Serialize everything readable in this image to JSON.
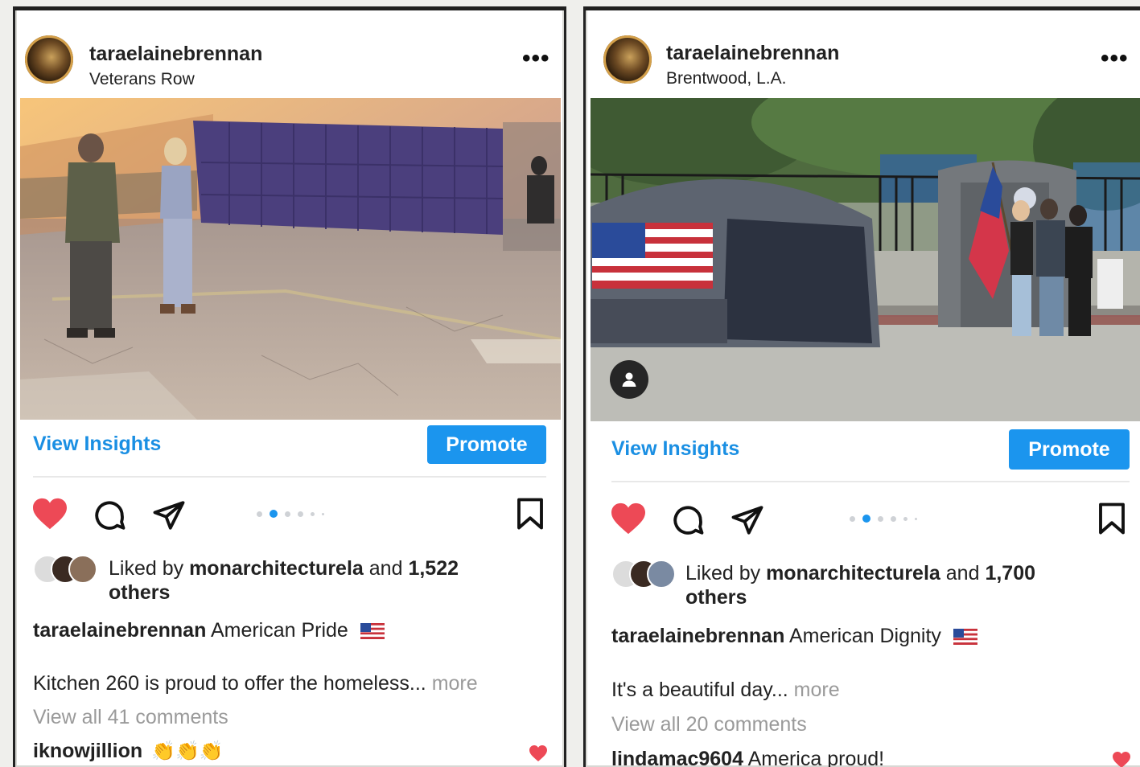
{
  "posts": [
    {
      "username": "taraelainebrennan",
      "location": "Veterans Row",
      "menu_icon": "more-horizontal-icon",
      "view_insights": "View Insights",
      "promote": "Promote",
      "liked_by_prefix": "Liked by",
      "liked_by_user": "monarchitecturela",
      "liked_by_and": "and",
      "liked_by_count": "1,522",
      "liked_by_suffix": "others",
      "caption_user": "taraelainebrennan",
      "caption_text": "American Pride",
      "caption_emoji": "us-flag-icon",
      "body_text": "Kitchen 260 is proud to offer the homeless...",
      "more_label": "more",
      "view_comments": "View all 41 comments",
      "comment_user": "iknowjillion",
      "comment_text": "👏👏👏"
    },
    {
      "username": "taraelainebrennan",
      "location": "Brentwood, L.A.",
      "menu_icon": "more-horizontal-icon",
      "view_insights": "View Insights",
      "promote": "Promote",
      "liked_by_prefix": "Liked by",
      "liked_by_user": "monarchitecturela",
      "liked_by_and": "and",
      "liked_by_count": "1,700",
      "liked_by_suffix": "others",
      "caption_user": "taraelainebrennan",
      "caption_text": "American Dignity",
      "caption_emoji": "us-flag-icon",
      "body_text": "It's a beautiful day...",
      "more_label": "more",
      "view_comments": "View all 20 comments",
      "comment_user": "lindamac9604",
      "comment_text": "America proud!"
    }
  ],
  "colors": {
    "accent": "#1b95ee",
    "like": "#ed4956",
    "muted": "#9a9a9a"
  },
  "carousel": {
    "active_index": 1,
    "count": 6
  }
}
